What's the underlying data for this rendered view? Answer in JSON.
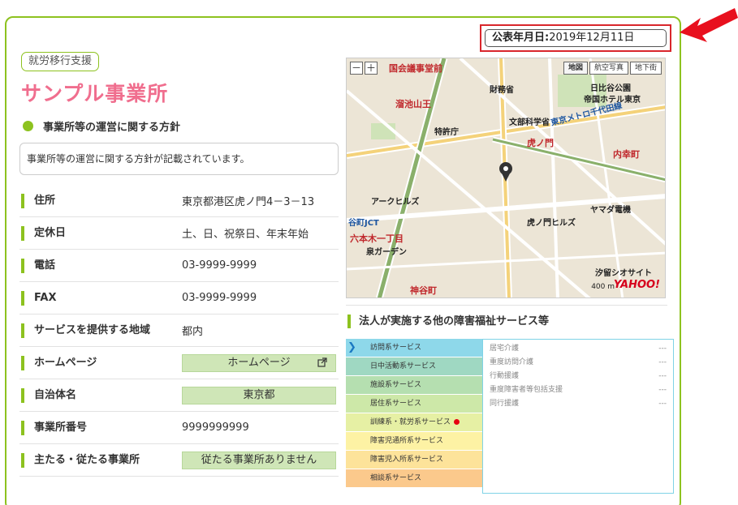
{
  "publication": {
    "label": "公表年月日:",
    "date": "2019年12月11日"
  },
  "category_tag": "就労移行支援",
  "office_name": "サンプル事業所",
  "policy": {
    "heading": "事業所等の運営に関する方針",
    "text": "事業所等の運営に関する方針が記載されています。"
  },
  "info": {
    "address": {
      "label": "住所",
      "value": "東京都港区虎ノ門4－3－13"
    },
    "holidays": {
      "label": "定休日",
      "value": "土、日、祝祭日、年末年始"
    },
    "phone": {
      "label": "電話",
      "value": "03-9999-9999"
    },
    "fax": {
      "label": "FAX",
      "value": "03-9999-9999"
    },
    "area": {
      "label": "サービスを提供する地域",
      "value": "都内"
    },
    "homepage": {
      "label": "ホームページ",
      "button": "ホームページ"
    },
    "municipality": {
      "label": "自治体名",
      "button": "東京都"
    },
    "office_number": {
      "label": "事業所番号",
      "value": "9999999999"
    },
    "main_sub": {
      "label": "主たる・従たる事業所",
      "button": "従たる事業所ありません"
    }
  },
  "map": {
    "zoom_out": "－",
    "zoom_in": "＋",
    "tabs": [
      "地図",
      "航空写真",
      "地下街"
    ],
    "labels": {
      "l1": "国会議事堂前",
      "l2": "溜池山王",
      "l3": "財務省",
      "l4": "日比谷公園",
      "l5": "帝国ホテル東京",
      "l6": "文部科学省",
      "l7": "特許庁",
      "l8": "虎ノ門",
      "l9": "内幸町",
      "l10": "アークヒルズ",
      "l11": "虎ノ門ヒルズ",
      "l12": "六本木一丁目",
      "l13": "泉ガーデン",
      "l14": "谷町JCT",
      "l15": "神谷町",
      "l16": "東京メトロ千代田線",
      "l17": "ヤマダ電機",
      "l18": "汐留シオサイト"
    },
    "scale": "400 m",
    "logo": "YAHOO!"
  },
  "services": {
    "heading": "法人が実施する他の障害福祉サービス等",
    "categories": [
      {
        "label": "訪問系サービス",
        "color": "#8ed8ea"
      },
      {
        "label": "日中活動系サービス",
        "color": "#9fd8c2"
      },
      {
        "label": "施設系サービス",
        "color": "#b5dfb0"
      },
      {
        "label": "居住系サービス",
        "color": "#cde8a8"
      },
      {
        "label": "訓練系・就労系サービス",
        "color": "#e6f0a4"
      },
      {
        "label": "障害児通所系サービス",
        "color": "#fdf2a4"
      },
      {
        "label": "障害児入所系サービス",
        "color": "#fde39a"
      },
      {
        "label": "相談系サービス",
        "color": "#fbc98c"
      }
    ],
    "sub_items": [
      {
        "label": "居宅介護",
        "value": "---"
      },
      {
        "label": "重度訪問介護",
        "value": "---"
      },
      {
        "label": "行動援護",
        "value": "---"
      },
      {
        "label": "重度障害者等包括支援",
        "value": "---"
      },
      {
        "label": "同行援護",
        "value": "---"
      }
    ]
  },
  "colors": {
    "accent_green": "#8dc21f",
    "title_pink": "#f06e8e",
    "highlight_red": "#d9262c"
  }
}
